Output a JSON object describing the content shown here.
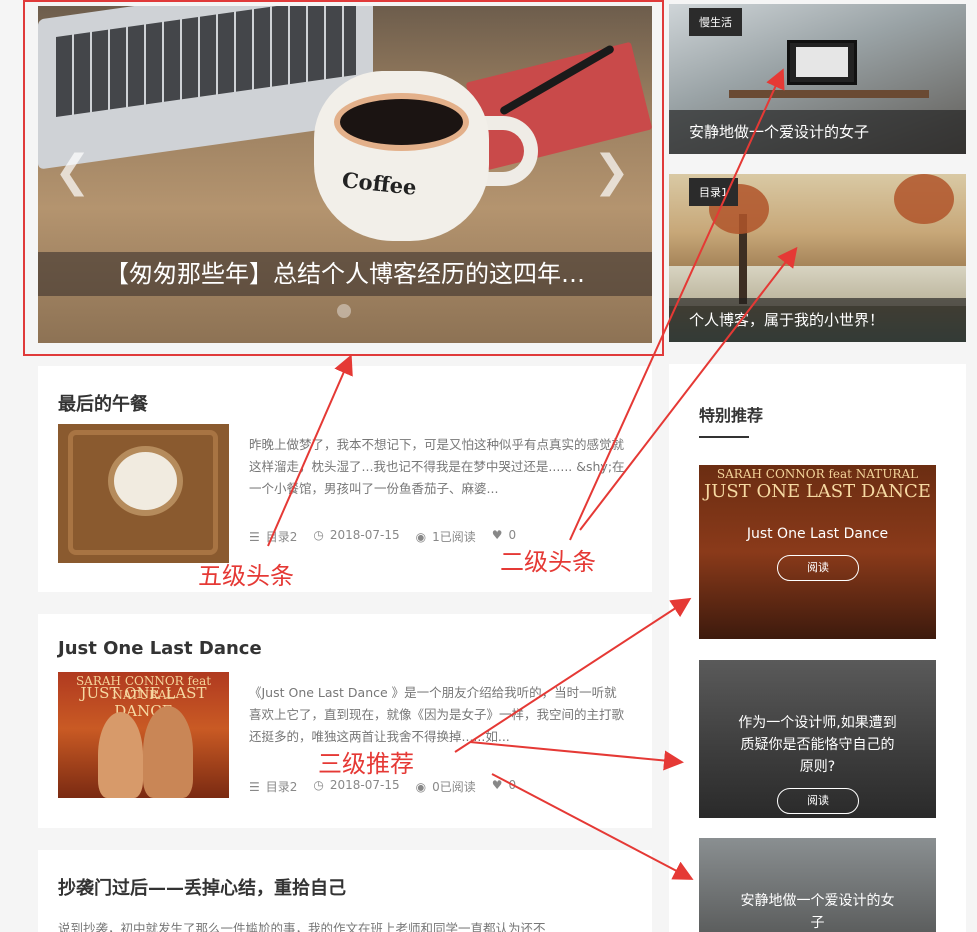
{
  "slider": {
    "caption": "【匆匆那些年】总结个人博客经历的这四年…",
    "cup_text": "Coffee",
    "prev": "❮",
    "next": "❯"
  },
  "side_cards": [
    {
      "tag": "慢生活",
      "title": "安静地做一个爱设计的女子"
    },
    {
      "tag": "目录1",
      "title": "个人博客，属于我的小世界！"
    }
  ],
  "posts": [
    {
      "title": "最后的午餐",
      "excerpt": "昨晚上做梦了，我本不想记下，可是又怕这种似乎有点真实的感觉就这样溜走，枕头湿了...我也记不得我是在梦中哭过还是...... &shy;在一个小餐馆，男孩叫了一份鱼香茄子、麻婆...",
      "category": "目录2",
      "date": "2018-07-15",
      "views": "1已阅读",
      "likes": "0"
    },
    {
      "title": "Just One Last Dance",
      "excerpt": "《Just One Last Dance 》是一个朋友介绍给我听的，当时一听就喜欢上它了，直到现在，就像《因为是女子》一样，我空间的主打歌还挺多的，唯独这两首让我舍不得换掉......如...",
      "category": "目录2",
      "date": "2018-07-15",
      "views": "0已阅读",
      "likes": "0"
    },
    {
      "title": "抄袭门过后——丢掉心结，重拾自己",
      "excerpt": "说到抄袭，初中就发生了那么一件尴尬的事，我的作文在班上老师和同学一直都认为还不"
    }
  ],
  "poster": {
    "top": "SARAH CONNOR feat NATURAL",
    "big": "JUST ONE LAST DANCE"
  },
  "recommend": {
    "heading": "特别推荐",
    "items": [
      {
        "title": "Just One Last Dance",
        "button": "阅读"
      },
      {
        "title": "作为一个设计师,如果遭到质疑你是否能恪守自己的原则?",
        "button": "阅读"
      },
      {
        "title": "安静地做一个爱设计的女子"
      }
    ]
  },
  "annotations": {
    "level5": "五级头条",
    "level2": "二级头条",
    "level3": "三级推荐"
  },
  "icons": {
    "category": "list-icon",
    "date": "clock-icon",
    "views": "eye-icon",
    "likes": "heart-icon"
  },
  "colors": {
    "annotation": "#e53935",
    "page_bg": "#f5f5f5"
  }
}
